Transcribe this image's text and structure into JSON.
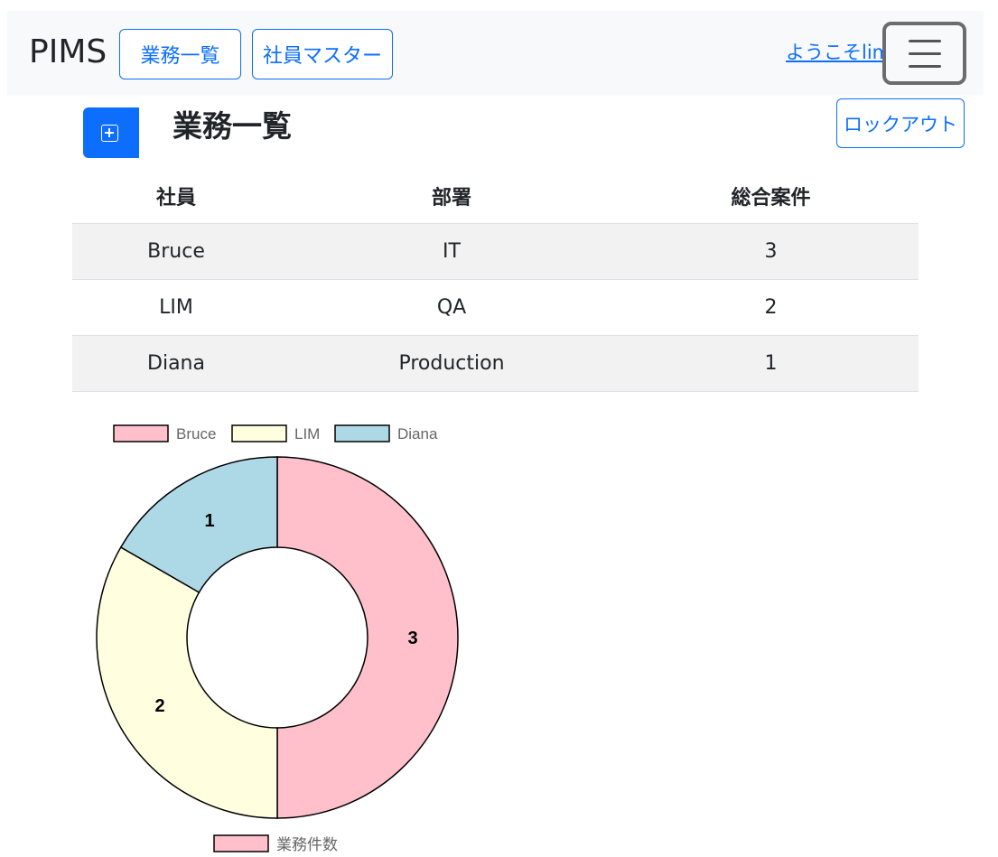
{
  "navbar": {
    "brand": "PIMS",
    "btn_jobs": "業務一覧",
    "btn_staff": "社員マスター",
    "welcome": "ようこそlim"
  },
  "page": {
    "title": "業務一覧",
    "logout": "ロックアウト"
  },
  "table": {
    "headers": [
      "社員",
      "部署",
      "総合案件"
    ],
    "rows": [
      [
        "Bruce",
        "IT",
        "3"
      ],
      [
        "LIM",
        "QA",
        "2"
      ],
      [
        "Diana",
        "Production",
        "1"
      ]
    ]
  },
  "chart_data": {
    "type": "pie",
    "categories": [
      "Bruce",
      "LIM",
      "Diana"
    ],
    "values": [
      3,
      2,
      1
    ],
    "colors": [
      "#ffc0cb",
      "#ffffe0",
      "#add8e6"
    ],
    "series_name": "業務件数",
    "legend_top": [
      "Bruce",
      "LIM",
      "Diana"
    ],
    "legend_bottom": "業務件数",
    "donut": true
  }
}
